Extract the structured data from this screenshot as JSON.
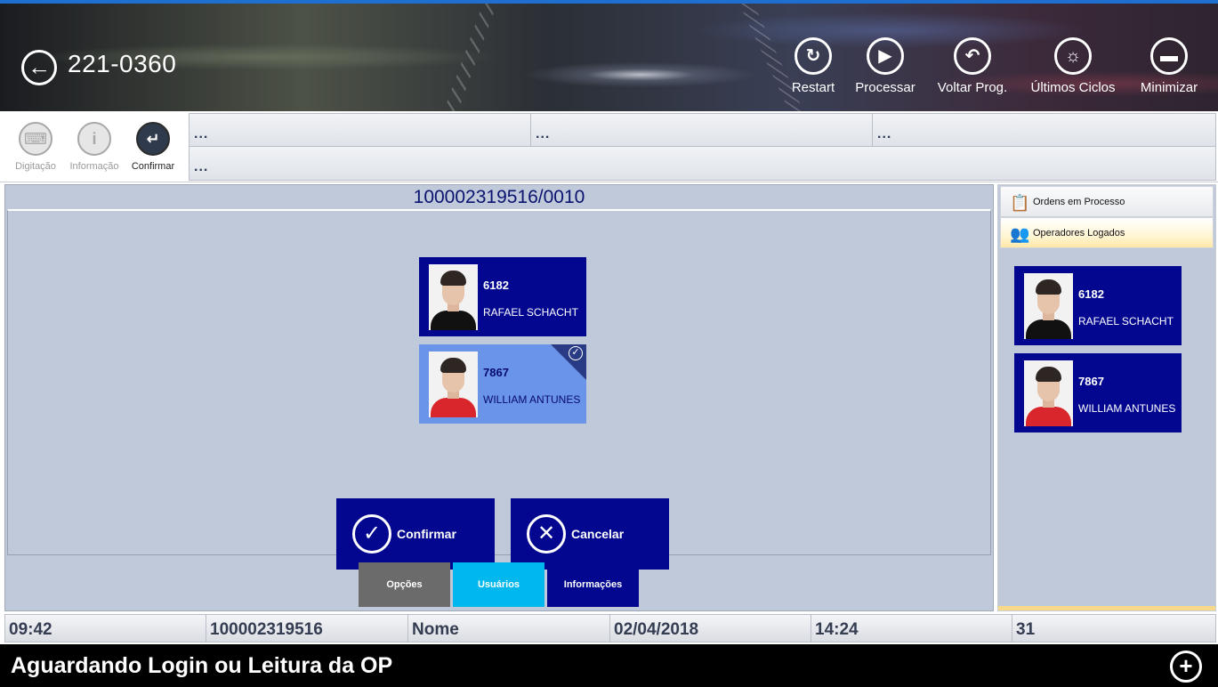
{
  "header": {
    "machine_code": "221-0360",
    "buttons": [
      {
        "label": "Restart",
        "icon": "refresh-icon"
      },
      {
        "label": "Processar",
        "icon": "play-icon"
      },
      {
        "label": "Voltar Prog.",
        "icon": "undo-icon"
      },
      {
        "label": "Últimos Ciclos",
        "icon": "lightbulb-icon"
      },
      {
        "label": "Minimizar",
        "icon": "minus-icon"
      }
    ]
  },
  "toolbar": {
    "tools": [
      {
        "label": "Digitação",
        "icon": "keyboard-icon",
        "active": false
      },
      {
        "label": "Informação",
        "icon": "info-icon",
        "active": false
      },
      {
        "label": "Confirmar",
        "icon": "enter-icon",
        "active": true
      }
    ],
    "info_cells": [
      "...",
      "...",
      "...",
      "..."
    ]
  },
  "main": {
    "order_title": "100002319516/0010",
    "operators": [
      {
        "code": "6182",
        "name": "RAFAEL SCHACHT",
        "selected": false
      },
      {
        "code": "7867",
        "name": "WILLIAM ANTUNES",
        "selected": true
      }
    ],
    "confirm_label": "Confirmar",
    "cancel_label": "Cancelar",
    "tabs": [
      {
        "label": "Opções",
        "color": "#6b6b6b"
      },
      {
        "label": "Usuários",
        "color": "#00b8ee"
      },
      {
        "label": "Informações",
        "color": "#030790"
      }
    ]
  },
  "side": {
    "tabs": [
      {
        "label": "Ordens em Processo",
        "icon": "clipboard-icon"
      },
      {
        "label": "Operadores Logados",
        "icon": "users-icon"
      }
    ],
    "operators": [
      {
        "code": "6182",
        "name": "RAFAEL SCHACHT"
      },
      {
        "code": "7867",
        "name": "WILLIAM ANTUNES"
      }
    ]
  },
  "status": {
    "time": "09:42",
    "order": "100002319516",
    "name": "Nome",
    "date": "02/04/2018",
    "time2": "14:24",
    "count": "31"
  },
  "bottom": {
    "message": "Aguardando Login ou Leitura da OP"
  },
  "colors": {
    "card_blue": "#030790",
    "card_selected": "#6a94e8",
    "panel_bg": "#bfc9d9",
    "accent_top": "#1e6fd0"
  }
}
